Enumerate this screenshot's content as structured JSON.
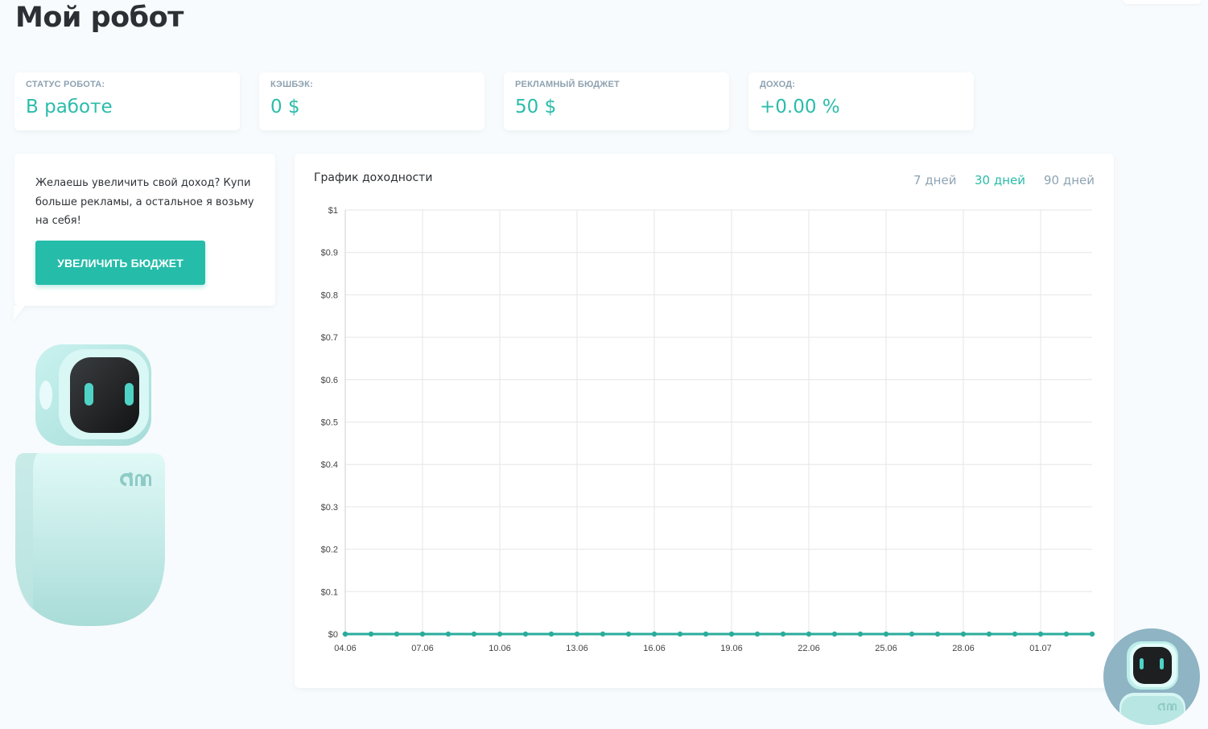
{
  "page": {
    "title": "Мой робот"
  },
  "stats": [
    {
      "label": "Статус робота:",
      "value": "В работе"
    },
    {
      "label": "Кэшбэк:",
      "value": "0 $"
    },
    {
      "label": "Рекламный бюджет",
      "value": "50 $"
    },
    {
      "label": "Доход:",
      "value": "+0.00 %"
    }
  ],
  "promo": {
    "text": "Желаешь увеличить свой доход? Купи больше рекламы, а остальное я возьму на себя!",
    "button_label": "УВЕЛИЧИТЬ БЮДЖЕТ"
  },
  "robot": {
    "logo_icon": "dm-logo-icon"
  },
  "chart": {
    "title": "График доходности",
    "periods": [
      {
        "label": "7 дней",
        "active": false
      },
      {
        "label": "30 дней",
        "active": true
      },
      {
        "label": "90 дней",
        "active": false
      }
    ]
  },
  "colors": {
    "accent": "#2bbcaa",
    "button": "#25bca9",
    "muted_label": "#8ea2b1",
    "grid": "#e6e6e6",
    "series_line": "#2aac9c"
  },
  "chart_data": {
    "type": "line",
    "title": "График доходности",
    "xlabel": "",
    "ylabel": "",
    "ylim": [
      0,
      1
    ],
    "yticks": [
      "$0",
      "$0.1",
      "$0.2",
      "$0.3",
      "$0.4",
      "$0.5",
      "$0.6",
      "$0.7",
      "$0.8",
      "$0.9",
      "$1"
    ],
    "xticks": [
      "04.06",
      "07.06",
      "10.06",
      "13.06",
      "16.06",
      "19.06",
      "22.06",
      "25.06",
      "28.06",
      "01.07"
    ],
    "grid": true,
    "legend": "none",
    "x": [
      "04.06",
      "05.06",
      "06.06",
      "07.06",
      "08.06",
      "09.06",
      "10.06",
      "11.06",
      "12.06",
      "13.06",
      "14.06",
      "15.06",
      "16.06",
      "17.06",
      "18.06",
      "19.06",
      "20.06",
      "21.06",
      "22.06",
      "23.06",
      "24.06",
      "25.06",
      "26.06",
      "27.06",
      "28.06",
      "29.06",
      "30.06",
      "01.07",
      "02.07",
      "03.07"
    ],
    "series": [
      {
        "values": [
          0,
          0,
          0,
          0,
          0,
          0,
          0,
          0,
          0,
          0,
          0,
          0,
          0,
          0,
          0,
          0,
          0,
          0,
          0,
          0,
          0,
          0,
          0,
          0,
          0,
          0,
          0,
          0,
          0,
          0
        ]
      }
    ]
  }
}
